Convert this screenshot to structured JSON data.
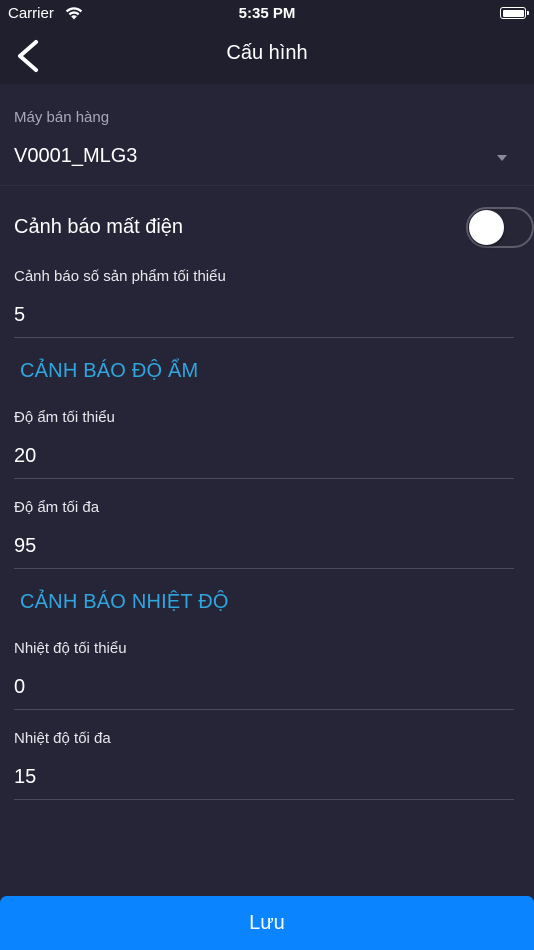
{
  "status_bar": {
    "carrier": "Carrier",
    "time": "5:35 PM"
  },
  "nav": {
    "title": "Cấu hình",
    "back_icon": "chevron-left-icon"
  },
  "machine": {
    "label": "Máy bán hàng",
    "value": "V0001_MLG3"
  },
  "power_alert": {
    "label": "Cảnh báo mất điện",
    "enabled": false
  },
  "min_products": {
    "label": "Cảnh báo số sản phẩm tối thiểu",
    "value": "5"
  },
  "humidity": {
    "section_title": "CẢNH BÁO ĐỘ ẨM",
    "min_label": "Độ ẩm tối thiểu",
    "min_value": "20",
    "max_label": "Độ ẩm tối đa",
    "max_value": "95"
  },
  "temperature": {
    "section_title": "CẢNH BÁO NHIỆT ĐỘ",
    "min_label": "Nhiệt độ tối thiểu",
    "min_value": "0",
    "max_label": "Nhiệt độ tối đa",
    "max_value": "15"
  },
  "actions": {
    "save_label": "Lưu"
  },
  "colors": {
    "background": "#252537",
    "header": "#1f1f2e",
    "accent": "#2fa6e0",
    "button": "#0a84ff"
  }
}
